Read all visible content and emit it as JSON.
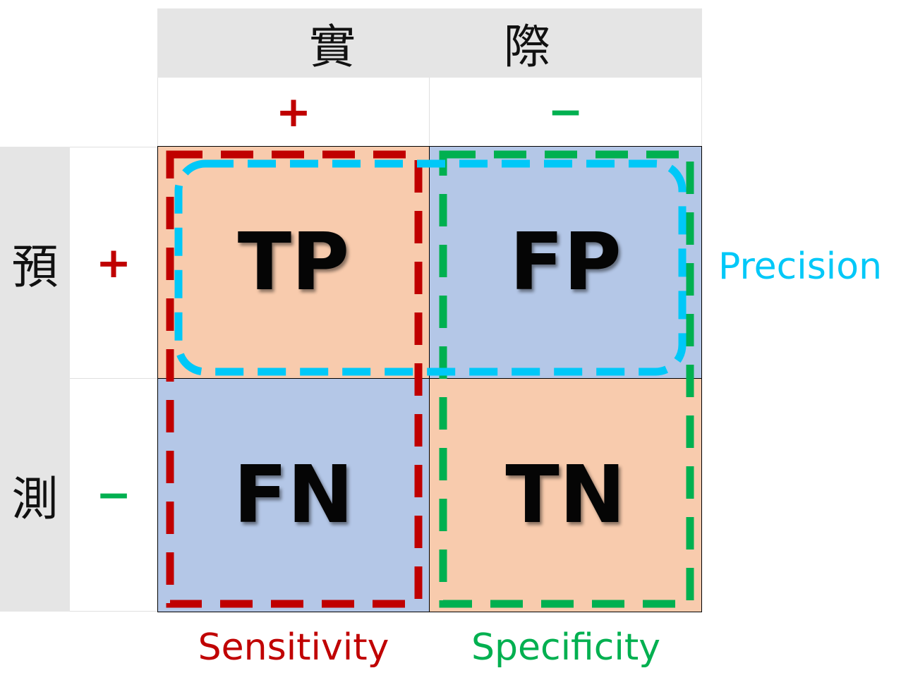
{
  "actual": {
    "header": "實          際",
    "pos_sign": "+",
    "neg_sign": "−"
  },
  "predicted": {
    "char1": "預",
    "char2": "測",
    "pos_sign": "+",
    "neg_sign": "−"
  },
  "cells": {
    "tp": "TP",
    "fp": "FP",
    "fn": "FN",
    "tn": "TN"
  },
  "metrics": {
    "precision": "Precision",
    "sensitivity": "Sensitivity",
    "specificity": "Specificity"
  },
  "colors": {
    "positive_sign": "#c00000",
    "negative_sign": "#00b050",
    "true_cell": "#f8cbad",
    "false_cell": "#b4c7e7",
    "precision": "#00c8f8",
    "sensitivity": "#c00000",
    "specificity": "#00b050"
  }
}
